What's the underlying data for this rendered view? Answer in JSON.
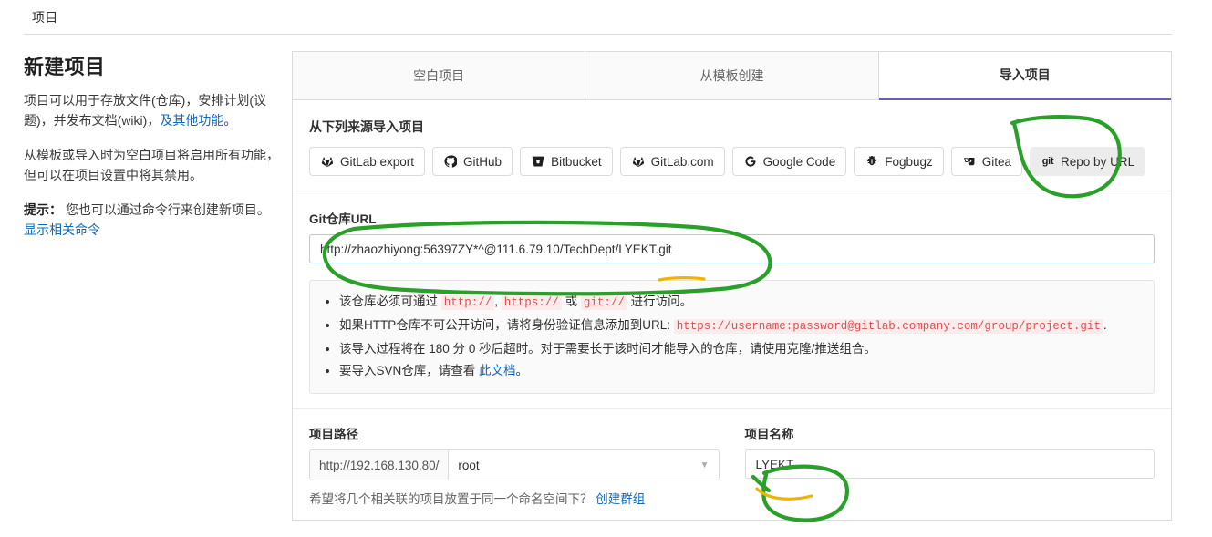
{
  "breadcrumb": {
    "text": "项目"
  },
  "left": {
    "title": "新建项目",
    "para1_a": "项目可以用于存放文件(仓库)，安排计划(议题)，并发布文档(wiki)，",
    "para1_link": "及其他功能",
    "para1_b": "。",
    "para2": "从模板或导入时为空白项目将启用所有功能，但可以在项目设置中将其禁用。",
    "hint_label": "提示：",
    "hint_text": "您也可以通过命令行来创建新项目。",
    "hint_link": "显示相关命令"
  },
  "tabs": [
    {
      "label": "空白项目",
      "active": false
    },
    {
      "label": "从模板创建",
      "active": false
    },
    {
      "label": "导入项目",
      "active": true
    }
  ],
  "import": {
    "section_title": "从下列来源导入项目",
    "sources": [
      {
        "label": "GitLab export",
        "icon": "gitlab-fox-icon",
        "selected": false
      },
      {
        "label": "GitHub",
        "icon": "github-icon",
        "selected": false
      },
      {
        "label": "Bitbucket",
        "icon": "bitbucket-icon",
        "selected": false
      },
      {
        "label": "GitLab.com",
        "icon": "gitlab-fox-icon",
        "selected": false
      },
      {
        "label": "Google Code",
        "icon": "google-icon",
        "selected": false
      },
      {
        "label": "Fogbugz",
        "icon": "fogbugz-bug-icon",
        "selected": false
      },
      {
        "label": "Gitea",
        "icon": "gitea-icon",
        "selected": false
      },
      {
        "label": "Repo by URL",
        "icon": "git-icon",
        "selected": true
      }
    ]
  },
  "git_url": {
    "label": "Git仓库URL",
    "value": "http://zhaozhiyong:56397ZY*^@111.6.79.10/TechDept/LYEKT.git",
    "placeholder": ""
  },
  "notes": {
    "b1_a": "该仓库必须可通过 ",
    "b1_c1": "http://",
    "b1_b": ", ",
    "b1_c2": "https://",
    "b1_d": " 或 ",
    "b1_c3": "git://",
    "b1_e": " 进行访问。",
    "b2_a": "如果HTTP仓库不可公开访问，请将身份验证信息添加到URL: ",
    "b2_code": "https://username:password@gitlab.company.com/group/project.git",
    "b2_b": ".",
    "b3_a": "该导入过程将在 ",
    "b3_min": "180",
    "b3_b": " 分 ",
    "b3_sec": "0",
    "b3_c": " 秒后超时。对于需要长于该时间才能导入的仓库，请使用克隆/推送组合。",
    "b4_a": "要导入SVN仓库，请查看 ",
    "b4_link": "此文档",
    "b4_b": "。"
  },
  "project_path": {
    "label": "项目路径",
    "host": "http://192.168.130.80/",
    "namespace": "root",
    "chevron": "chevron-down-icon",
    "helper_text": "希望将几个相关联的项目放置于同一个命名空间下？",
    "helper_link": "创建群组"
  },
  "project_name": {
    "label": "项目名称",
    "value": "LYEKT",
    "placeholder": ""
  },
  "annotations": {
    "ink_green": "#2aa02a",
    "ink_yellow": "#f0b400",
    "accent_purple": "#6b5fb5",
    "link_blue": "#1068bf",
    "code_red": "#d9534f"
  }
}
